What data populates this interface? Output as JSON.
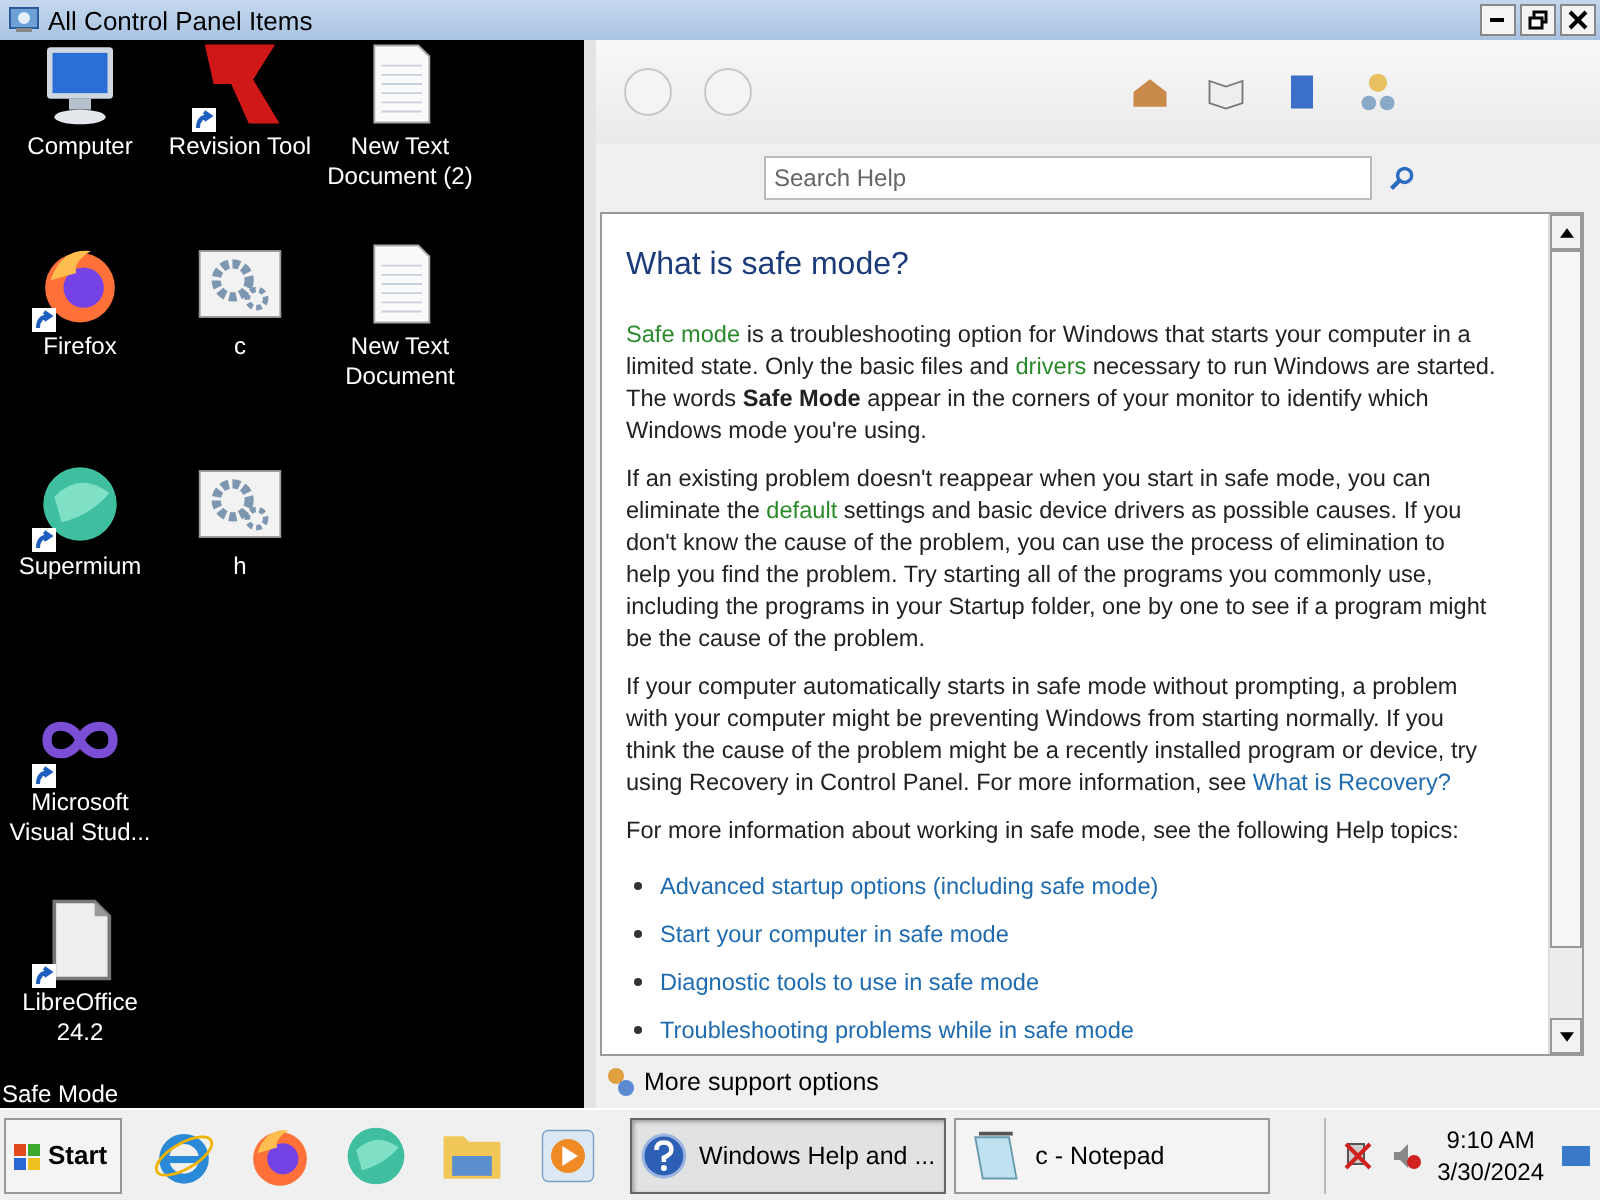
{
  "window": {
    "title": "All Control Panel Items"
  },
  "desktop": {
    "columns": [
      [
        {
          "label": "Computer",
          "kind": "computer",
          "shortcut": false
        },
        {
          "label": "Firefox",
          "kind": "firefox",
          "shortcut": true
        },
        {
          "label": "Supermium",
          "kind": "supermium",
          "shortcut": true
        },
        {
          "label": "Microsoft Visual Stud...",
          "kind": "infinity",
          "shortcut": true
        },
        {
          "label": "LibreOffice 24.2",
          "kind": "document",
          "shortcut": true
        }
      ],
      [
        {
          "label": "Revision Tool",
          "kind": "revision",
          "shortcut": true
        },
        {
          "label": "c",
          "kind": "gears",
          "shortcut": false
        },
        {
          "label": "h",
          "kind": "gears",
          "shortcut": false
        }
      ],
      [
        {
          "label": "New Text Document (2)",
          "kind": "textfile",
          "shortcut": false
        },
        {
          "label": "New Text Document",
          "kind": "textfile",
          "shortcut": false
        }
      ]
    ],
    "mode_label": "Safe Mode"
  },
  "help": {
    "search": {
      "placeholder": "Search Help"
    },
    "heading": "What is safe mode?",
    "paragraphs": [
      [
        {
          "kind": "term",
          "t": "Safe mode"
        },
        {
          "kind": "plain",
          "t": " is a troubleshooting option for Windows that starts your computer in a limited state. Only the basic files and "
        },
        {
          "kind": "term",
          "t": "drivers"
        },
        {
          "kind": "plain",
          "t": " necessary to run Windows are started. The words **Safe Mode** appear in the corners of your monitor to identify which Windows mode you're using."
        }
      ],
      [
        {
          "kind": "plain",
          "t": "If an existing problem doesn't reappear when you start in safe mode, you can eliminate the "
        },
        {
          "kind": "term",
          "t": "default"
        },
        {
          "kind": "plain",
          "t": " settings and basic device drivers as possible causes. If you don't know the cause of the problem, you can use the process of elimination to help you find the problem. Try starting all of the programs you commonly use, including the programs in your Startup folder, one by one to see if a program might be the cause of the problem."
        }
      ],
      [
        {
          "kind": "plain",
          "t": "If your computer automatically starts in safe mode without prompting, a problem with your computer might be preventing Windows from starting normally. If you think the cause of the problem might be a recently installed program or device, try using Recovery in Control Panel. For more information, see "
        },
        {
          "kind": "link",
          "t": "What is Recovery?"
        }
      ],
      [
        {
          "kind": "plain",
          "t": "For more information about working in safe mode, see the following Help topics:"
        }
      ]
    ],
    "topics": [
      "Advanced startup options (including safe mode)",
      "Start your computer in safe mode",
      "Diagnostic tools to use in safe mode",
      "Troubleshooting problems while in safe mode"
    ],
    "footer": "More support options"
  },
  "taskbar": {
    "start": "Start",
    "quick_launch": [
      {
        "kind": "ie"
      },
      {
        "kind": "firefox"
      },
      {
        "kind": "supermium"
      },
      {
        "kind": "folder"
      },
      {
        "kind": "media"
      }
    ],
    "tasks": [
      {
        "label": "Windows Help and ...",
        "kind": "help",
        "selected": true
      },
      {
        "label": "c - Notepad",
        "kind": "notepad",
        "selected": false
      }
    ],
    "clock": {
      "time": "9:10 AM",
      "date": "3/30/2024"
    }
  }
}
